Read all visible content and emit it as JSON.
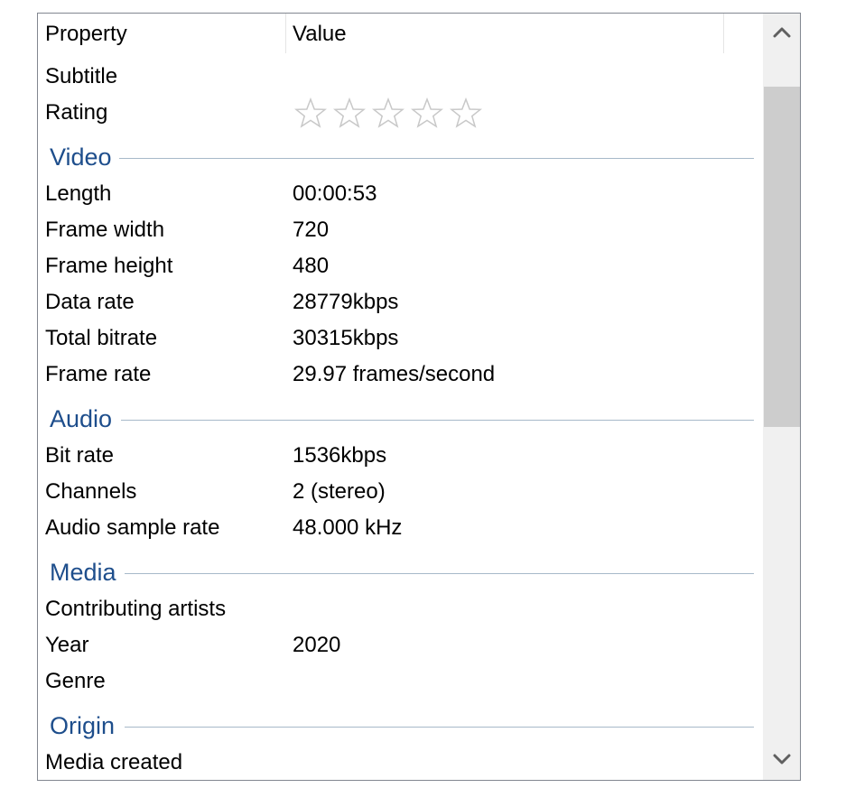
{
  "header": {
    "property_label": "Property",
    "value_label": "Value"
  },
  "rows_top": {
    "subtitle": {
      "key": "Subtitle",
      "value": ""
    },
    "rating": {
      "key": "Rating",
      "stars_filled": 0,
      "stars_total": 5
    }
  },
  "groups": {
    "video": {
      "title": "Video",
      "rows": [
        {
          "key": "Length",
          "value": "00:00:53"
        },
        {
          "key": "Frame width",
          "value": "720"
        },
        {
          "key": "Frame height",
          "value": "480"
        },
        {
          "key": "Data rate",
          "value": "28779kbps"
        },
        {
          "key": "Total bitrate",
          "value": "30315kbps"
        },
        {
          "key": "Frame rate",
          "value": "29.97 frames/second"
        }
      ]
    },
    "audio": {
      "title": "Audio",
      "rows": [
        {
          "key": "Bit rate",
          "value": "1536kbps"
        },
        {
          "key": "Channels",
          "value": "2 (stereo)"
        },
        {
          "key": "Audio sample rate",
          "value": "48.000 kHz"
        }
      ]
    },
    "media": {
      "title": "Media",
      "rows": [
        {
          "key": "Contributing artists",
          "value": ""
        },
        {
          "key": "Year",
          "value": "2020"
        },
        {
          "key": "Genre",
          "value": ""
        }
      ]
    },
    "origin": {
      "title": "Origin",
      "rows": [
        {
          "key": "Media created",
          "value": ""
        }
      ]
    }
  },
  "colors": {
    "group_title": "#1e4e8c",
    "group_line": "#a7b9c9",
    "star_outline": "#c8c8c8",
    "scroll_track": "#f0f0f0",
    "scroll_thumb": "#cdcdcd"
  },
  "icons": {
    "scroll_up": "chevron-up-icon",
    "scroll_down": "chevron-down-icon",
    "rating_star": "star-outline-icon"
  }
}
